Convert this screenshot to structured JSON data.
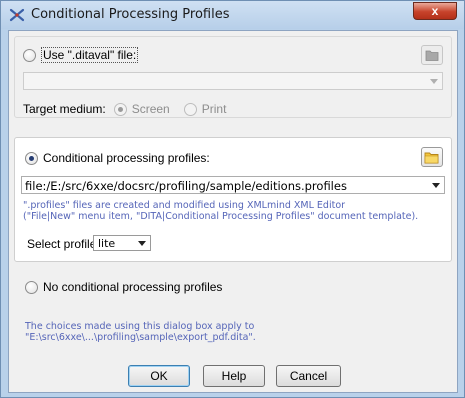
{
  "window": {
    "title": "Conditional Processing Profiles",
    "close_glyph": "x"
  },
  "ditaval": {
    "option_label": "Use \".ditaval\" file:",
    "file_value": "",
    "target_medium_label": "Target medium:",
    "screen_label": "Screen",
    "print_label": "Print",
    "icon": "folder-icon"
  },
  "profiles": {
    "option_label": "Conditional processing profiles:",
    "file_value": "file:/E:/src/6xxe/docsrc/profiling/sample/editions.profiles",
    "note_line1": "\".profiles\" files are created and modified using XMLmind XML Editor",
    "note_line2": "(\"File|New\" menu item, \"DITA|Conditional Processing Profiles\" document template).",
    "select_profile_label": "Select profile",
    "select_profile_value": "lite",
    "icon": "folder-icon"
  },
  "none_option": {
    "label": "No conditional processing profiles"
  },
  "footer_note": {
    "line1": "The choices made using this dialog box apply to",
    "line2": "\"E:\\src\\6xxe\\...\\profiling\\sample\\export_pdf.dita\"."
  },
  "buttons": {
    "ok": "OK",
    "help": "Help",
    "cancel": "Cancel"
  },
  "colors": {
    "note_text": "#5565b8",
    "title_bar": "#b9d1ea",
    "close_button": "#c7432b"
  }
}
